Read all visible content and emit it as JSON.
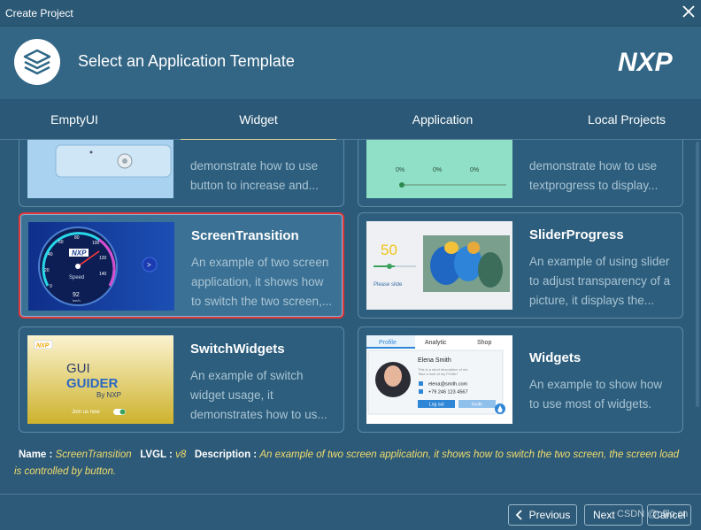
{
  "window": {
    "title": "Create Project"
  },
  "header": {
    "title": "Select an Application Template",
    "brand": "NXP"
  },
  "tabs": [
    {
      "label": "EmptyUI"
    },
    {
      "label": "Widget"
    },
    {
      "label": "Application"
    },
    {
      "label": "Local Projects"
    }
  ],
  "cards": {
    "partial_left": {
      "desc": "demonstrate how to use button to increase and..."
    },
    "partial_right": {
      "desc": "demonstrate how to use textprogress to display...",
      "thumb_pcts": [
        "0%",
        "0%",
        "0%"
      ]
    },
    "screen_transition": {
      "title": "ScreenTransition",
      "desc": "An example of two screen application, it shows how to switch the two screen,...",
      "thumb_brand": "NXP",
      "thumb_caption": "Speed",
      "thumb_unit": "km/h",
      "thumb_ticks": [
        "0",
        "20",
        "40",
        "60",
        "80",
        "100",
        "120",
        "140"
      ],
      "thumb_value": "92"
    },
    "slider_progress": {
      "title": "SliderProgress",
      "desc": "An example of using slider to adjust transparency of a picture, it displays the...",
      "thumb_value": "50",
      "thumb_label": "Please slide"
    },
    "switch_widgets": {
      "title": "SwitchWidgets",
      "desc": "An example of switch widget usage, it demonstrates how to us...",
      "thumb_line1": "GUI",
      "thumb_line2": "GUIDER",
      "thumb_line3": "By NXP",
      "thumb_switch": "Join us now"
    },
    "widgets": {
      "title": "Widgets",
      "desc": "An example to show how to use most of widgets.",
      "thumb_tabs": [
        "Profile",
        "Analytic",
        "Shop"
      ],
      "thumb_name": "Elena Smith",
      "thumb_bio": "This is a short description of me. Take a look at my Profile!",
      "thumb_email": "elena@smith.com",
      "thumb_phone": "+79 246 123 4567",
      "thumb_btn1": "Log out",
      "thumb_btn2": "Invite"
    }
  },
  "info": {
    "name_label": "Name :",
    "name_value": "ScreenTransition",
    "lvgl_label": "LVGL :",
    "lvgl_value": "v8",
    "desc_label": "Description :",
    "desc_value": "An example of two screen application, it shows how to switch the two screen, the screen load is controlled by button."
  },
  "buttons": {
    "previous": "Previous",
    "next": "Next",
    "cancel": "Cancel"
  },
  "watermark": "CSDN @ofllo.cn"
}
